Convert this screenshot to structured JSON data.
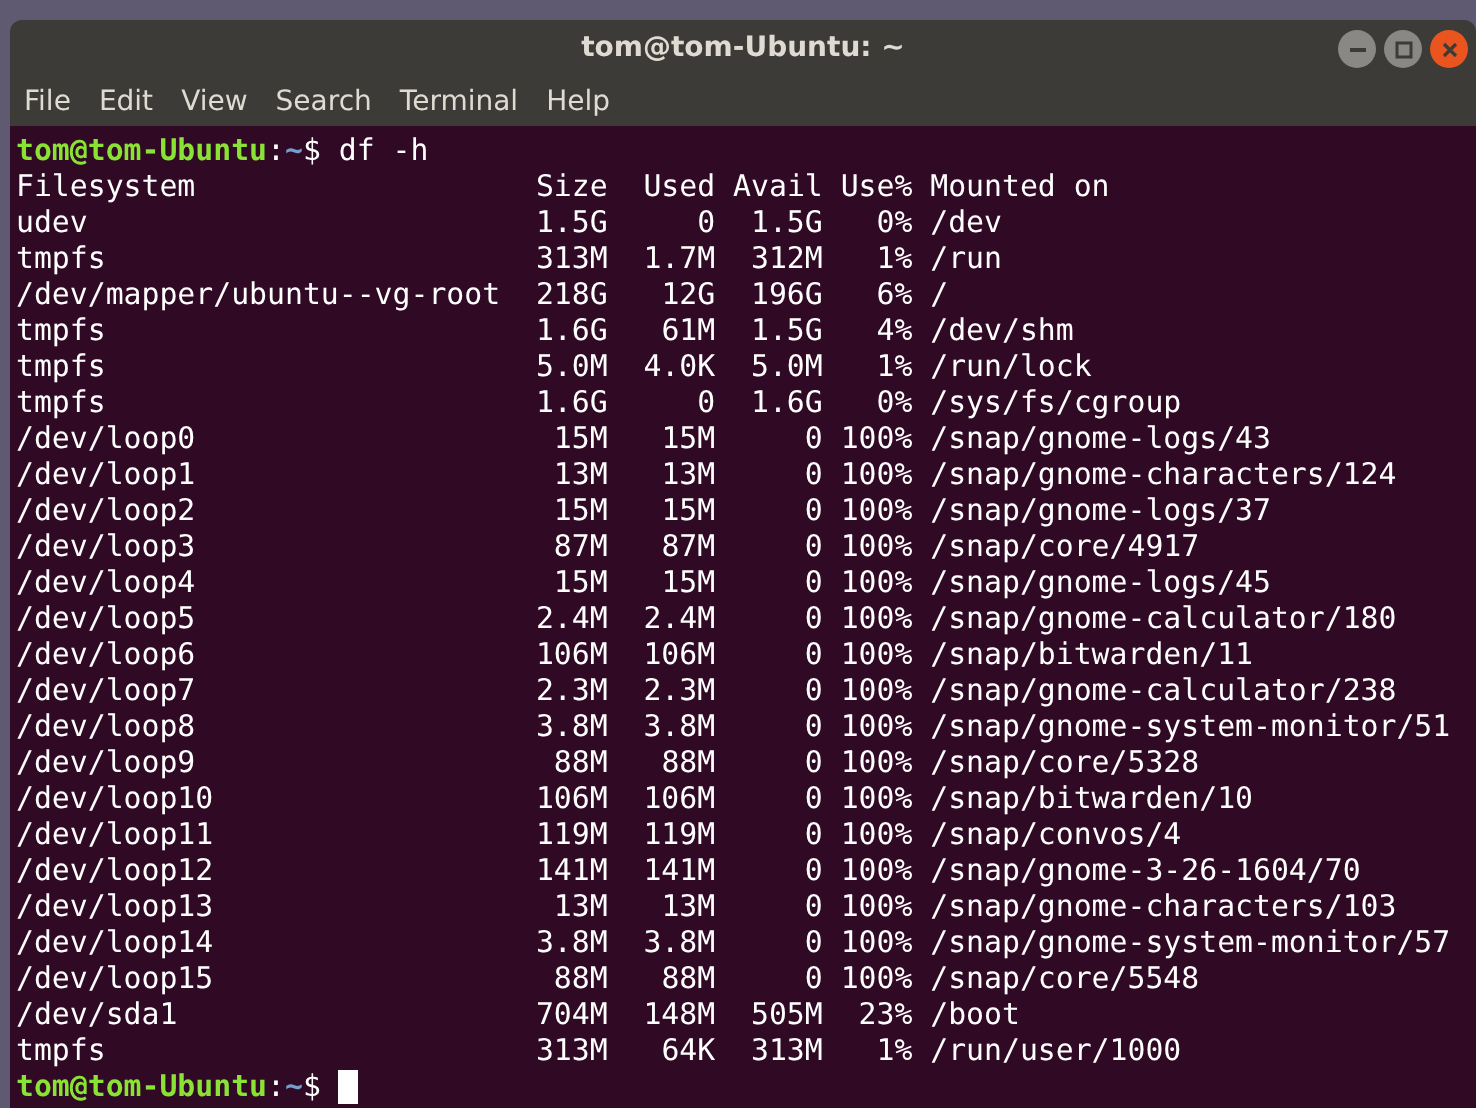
{
  "window": {
    "title": "tom@tom-Ubuntu: ~"
  },
  "menu": [
    "File",
    "Edit",
    "View",
    "Search",
    "Terminal",
    "Help"
  ],
  "terminal": {
    "prompt": {
      "user_host": "tom@tom-Ubuntu",
      "separator": ":",
      "path": "~",
      "symbol": "$",
      "command": "df -h"
    },
    "columns": [
      "Filesystem",
      "Size",
      "Used",
      "Avail",
      "Use%",
      "Mounted on"
    ],
    "rows": [
      [
        "udev",
        "1.5G",
        "0",
        "1.5G",
        "0%",
        "/dev"
      ],
      [
        "tmpfs",
        "313M",
        "1.7M",
        "312M",
        "1%",
        "/run"
      ],
      [
        "/dev/mapper/ubuntu--vg-root",
        "218G",
        "12G",
        "196G",
        "6%",
        "/"
      ],
      [
        "tmpfs",
        "1.6G",
        "61M",
        "1.5G",
        "4%",
        "/dev/shm"
      ],
      [
        "tmpfs",
        "5.0M",
        "4.0K",
        "5.0M",
        "1%",
        "/run/lock"
      ],
      [
        "tmpfs",
        "1.6G",
        "0",
        "1.6G",
        "0%",
        "/sys/fs/cgroup"
      ],
      [
        "/dev/loop0",
        "15M",
        "15M",
        "0",
        "100%",
        "/snap/gnome-logs/43"
      ],
      [
        "/dev/loop1",
        "13M",
        "13M",
        "0",
        "100%",
        "/snap/gnome-characters/124"
      ],
      [
        "/dev/loop2",
        "15M",
        "15M",
        "0",
        "100%",
        "/snap/gnome-logs/37"
      ],
      [
        "/dev/loop3",
        "87M",
        "87M",
        "0",
        "100%",
        "/snap/core/4917"
      ],
      [
        "/dev/loop4",
        "15M",
        "15M",
        "0",
        "100%",
        "/snap/gnome-logs/45"
      ],
      [
        "/dev/loop5",
        "2.4M",
        "2.4M",
        "0",
        "100%",
        "/snap/gnome-calculator/180"
      ],
      [
        "/dev/loop6",
        "106M",
        "106M",
        "0",
        "100%",
        "/snap/bitwarden/11"
      ],
      [
        "/dev/loop7",
        "2.3M",
        "2.3M",
        "0",
        "100%",
        "/snap/gnome-calculator/238"
      ],
      [
        "/dev/loop8",
        "3.8M",
        "3.8M",
        "0",
        "100%",
        "/snap/gnome-system-monitor/51"
      ],
      [
        "/dev/loop9",
        "88M",
        "88M",
        "0",
        "100%",
        "/snap/core/5328"
      ],
      [
        "/dev/loop10",
        "106M",
        "106M",
        "0",
        "100%",
        "/snap/bitwarden/10"
      ],
      [
        "/dev/loop11",
        "119M",
        "119M",
        "0",
        "100%",
        "/snap/convos/4"
      ],
      [
        "/dev/loop12",
        "141M",
        "141M",
        "0",
        "100%",
        "/snap/gnome-3-26-1604/70"
      ],
      [
        "/dev/loop13",
        "13M",
        "13M",
        "0",
        "100%",
        "/snap/gnome-characters/103"
      ],
      [
        "/dev/loop14",
        "3.8M",
        "3.8M",
        "0",
        "100%",
        "/snap/gnome-system-monitor/57"
      ],
      [
        "/dev/loop15",
        "88M",
        "88M",
        "0",
        "100%",
        "/snap/core/5548"
      ],
      [
        "/dev/sda1",
        "704M",
        "148M",
        "505M",
        "23%",
        "/boot"
      ],
      [
        "tmpfs",
        "313M",
        "64K",
        "313M",
        "1%",
        "/run/user/1000"
      ]
    ],
    "final_prompt": {
      "user_host": "tom@tom-Ubuntu",
      "separator": ":",
      "path": "~",
      "symbol": "$"
    }
  }
}
